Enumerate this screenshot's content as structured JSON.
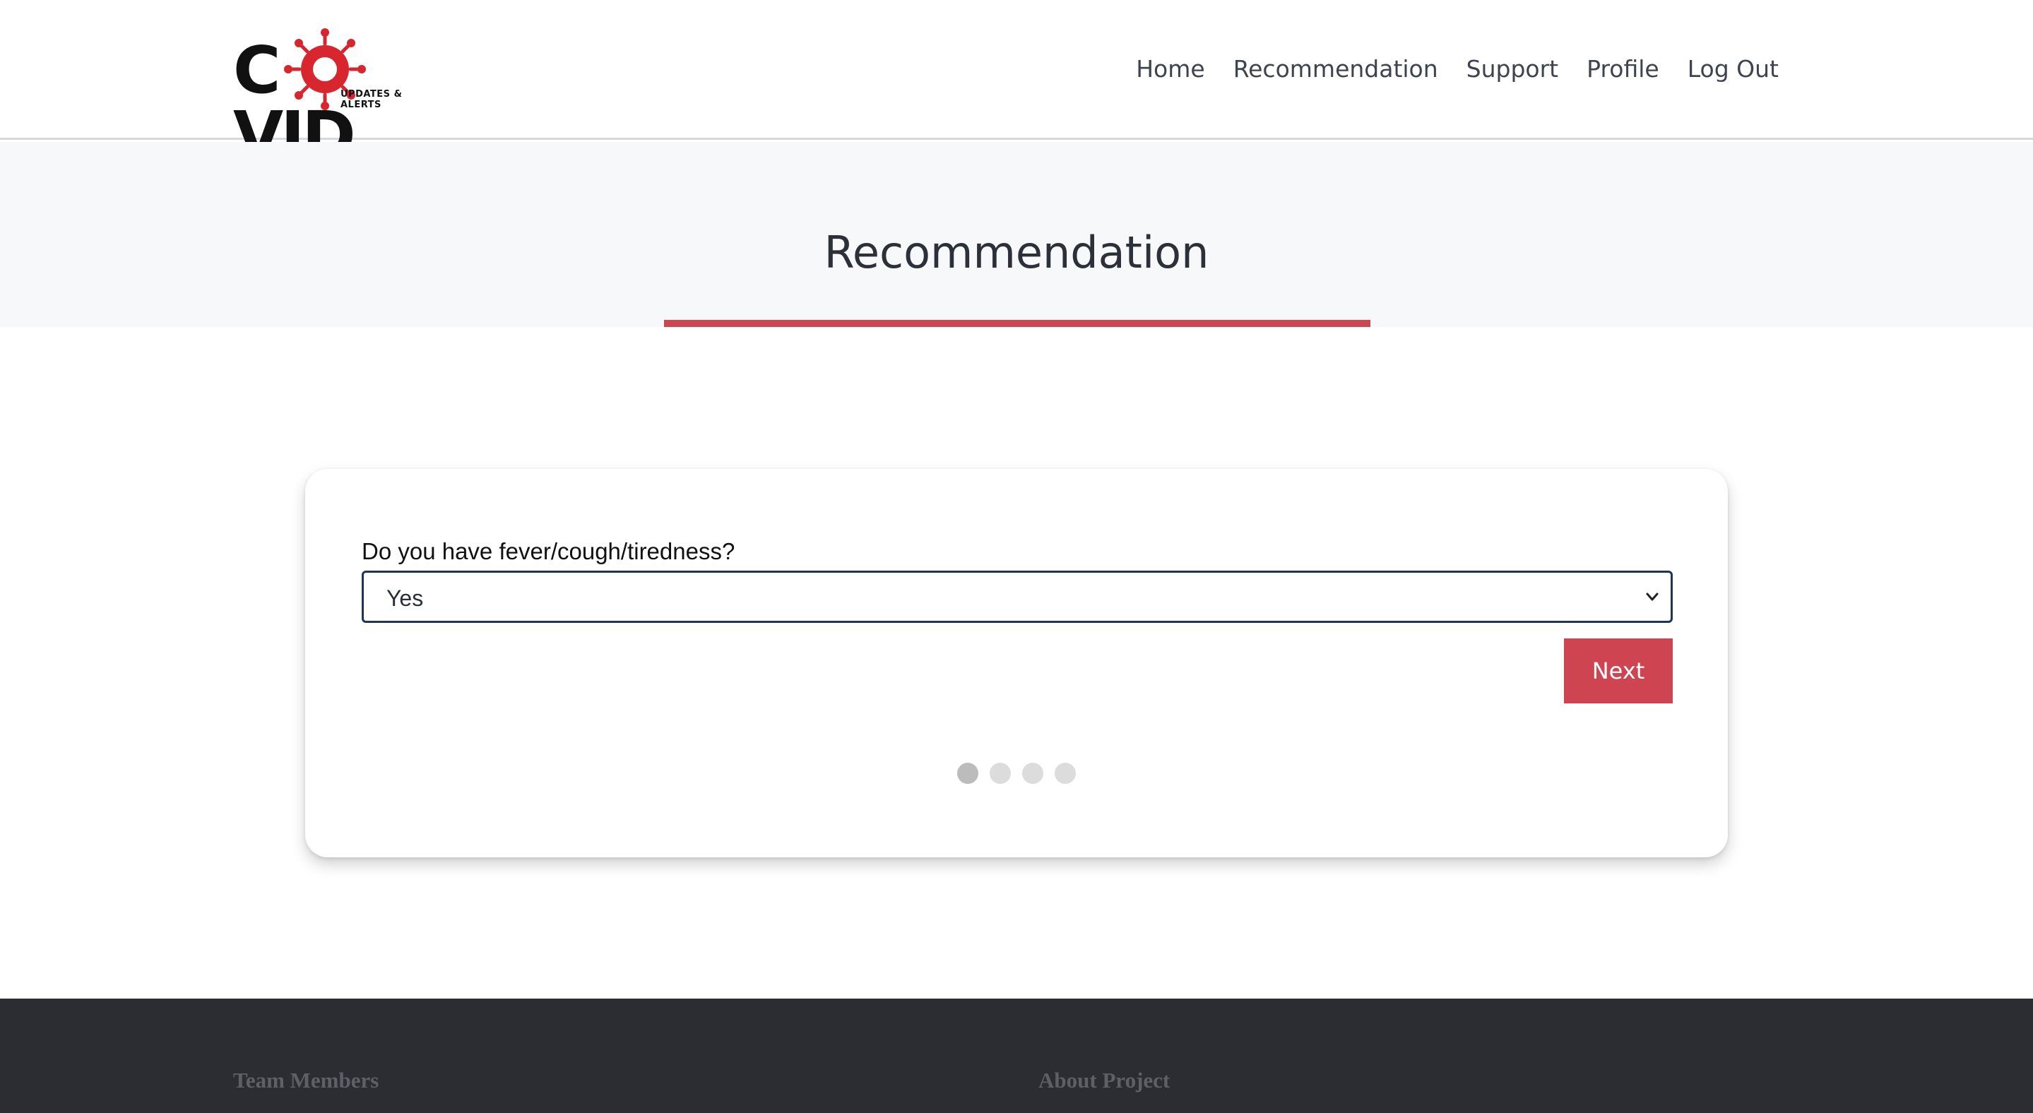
{
  "header": {
    "logo": {
      "word": "COVID",
      "sub": "UPDATES & ALERTS"
    },
    "nav": [
      {
        "label": "Home"
      },
      {
        "label": "Recommendation"
      },
      {
        "label": "Support"
      },
      {
        "label": "Profile"
      },
      {
        "label": "Log Out"
      }
    ]
  },
  "hero": {
    "title": "Recommendation"
  },
  "form": {
    "question": "Do you have fever/cough/tiredness?",
    "select_value": "Yes",
    "next_label": "Next",
    "steps_total": 4,
    "step_current": 1
  },
  "footer": {
    "team_heading": "Team Members",
    "about_heading": "About Project"
  },
  "colors": {
    "accent": "#cf4451",
    "footer_bg": "#2b2d32",
    "select_border": "#1e3556"
  },
  "icons": {
    "select": "chevron-down-icon",
    "logo": "virus-icon"
  }
}
